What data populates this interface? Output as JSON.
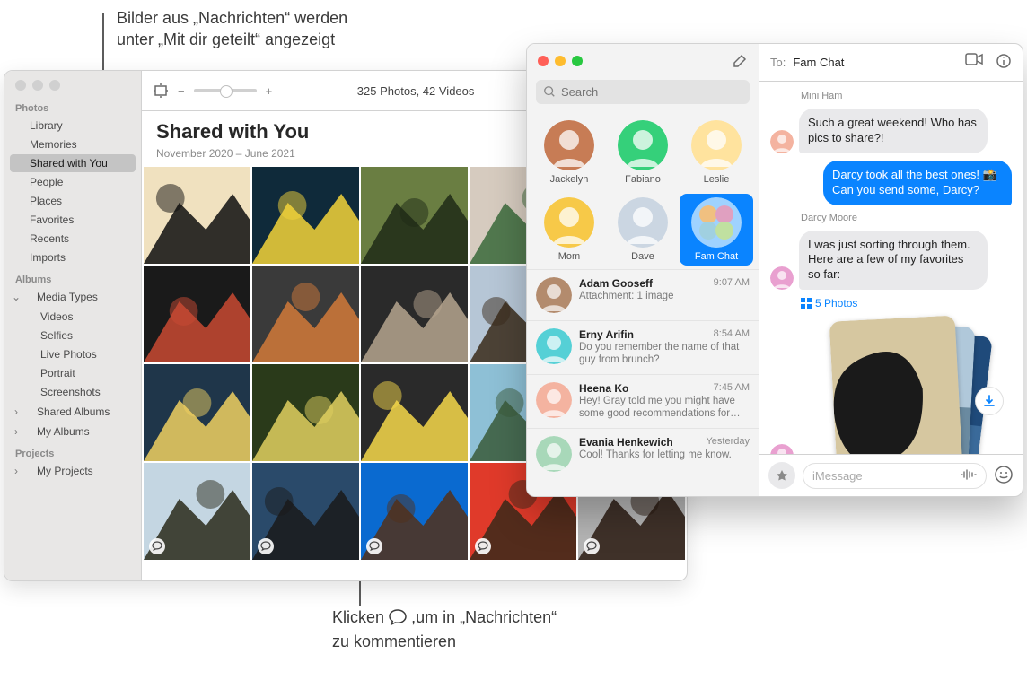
{
  "callouts": {
    "top_line1": "Bilder aus „Nachrichten“ werden",
    "top_line2": "unter „Mit dir geteilt“ angezeigt",
    "bottom_pre": "Klicken",
    "bottom_post": ",um in „Nachrichten“",
    "bottom_line2": "zu kommentieren"
  },
  "photos": {
    "toolbar": {
      "count": "325 Photos, 42 Videos"
    },
    "header": {
      "title": "Shared with You",
      "subtitle": "November 2020 – June 2021"
    },
    "sidebar": {
      "section_photos": "Photos",
      "items_photos": [
        "Library",
        "Memories",
        "Shared with You",
        "People",
        "Places",
        "Favorites",
        "Recents",
        "Imports"
      ],
      "section_albums": "Albums",
      "media_types_label": "Media Types",
      "media_types": [
        "Videos",
        "Selfies",
        "Live Photos",
        "Portrait",
        "Screenshots"
      ],
      "shared_albums": "Shared Albums",
      "my_albums": "My Albums",
      "section_projects": "Projects",
      "my_projects": "My Projects"
    }
  },
  "messages": {
    "search_placeholder": "Search",
    "pins": [
      {
        "name": "Jackelyn",
        "bg": "#c77c55"
      },
      {
        "name": "Fabiano",
        "bg": "#35d07a"
      },
      {
        "name": "Leslie",
        "bg": "#ffe39e"
      },
      {
        "name": "Mom",
        "bg": "#f7c948"
      },
      {
        "name": "Dave",
        "bg": "#cbd6e2"
      },
      {
        "name": "Fam Chat",
        "bg": "#9fd2ff"
      }
    ],
    "conversations": [
      {
        "name": "Adam Gooseff",
        "time": "9:07 AM",
        "preview": "Attachment: 1 image",
        "bg": "#b38b6d"
      },
      {
        "name": "Erny Arifin",
        "time": "8:54 AM",
        "preview": "Do you remember the name of that guy from brunch?",
        "bg": "#55d0d6"
      },
      {
        "name": "Heena Ko",
        "time": "7:45 AM",
        "preview": "Hey! Gray told me you might have some good recommendations for our…",
        "bg": "#f4b3a0"
      },
      {
        "name": "Evania Henkewich",
        "time": "Yesterday",
        "preview": "Cool! Thanks for letting me know.",
        "bg": "#a8d8b9"
      }
    ],
    "header": {
      "to_label": "To:",
      "to_value": "Fam Chat"
    },
    "thread": {
      "sender1": "Mini Ham",
      "msg1": "Such a great weekend! Who has pics to share?!",
      "msg_me": "Darcy took all the best ones! 📸 Can you send some, Darcy?",
      "sender2": "Darcy Moore",
      "msg2": "I was just sorting through them. Here are a few of my favorites so far:",
      "stack_label": "5 Photos"
    },
    "composer": {
      "placeholder": "iMessage"
    }
  },
  "photo_cells": [
    {
      "c1": "#f0e1bf",
      "c2": "#0e0e0e"
    },
    {
      "c1": "#0f2a3a",
      "c2": "#f3d33a"
    },
    {
      "c1": "#6a7e42",
      "c2": "#1e2a16"
    },
    {
      "c1": "#d6cbbf",
      "c2": "#3a6a3a"
    },
    {
      "c1": "#b9cbb9",
      "c2": "#6a4a2a"
    },
    {
      "c1": "#1a1a1a",
      "c2": "#c94a33"
    },
    {
      "c1": "#3a3a3a",
      "c2": "#d27a3a"
    },
    {
      "c1": "#2a2a2a",
      "c2": "#b5a48e"
    },
    {
      "c1": "#b6c6d6",
      "c2": "#3a2a1a"
    },
    {
      "c1": "#e0d6cb",
      "c2": "#3a2a1a"
    },
    {
      "c1": "#1f364a",
      "c2": "#f0d060"
    },
    {
      "c1": "#2a3a1a",
      "c2": "#e0d060"
    },
    {
      "c1": "#2a2a2a",
      "c2": "#f6d84a"
    },
    {
      "c1": "#8ec0d6",
      "c2": "#3a5a3a"
    },
    {
      "c1": "#d6e0cb",
      "c2": "#3a2a1a"
    },
    {
      "c1": "#c4d6e2",
      "c2": "#2a2a1a"
    },
    {
      "c1": "#2a4a6a",
      "c2": "#1a1a1a"
    },
    {
      "c1": "#0a6ad0",
      "c2": "#52301a"
    },
    {
      "c1": "#e03a2a",
      "c2": "#3a2a1a"
    },
    {
      "c1": "#b5b5b5",
      "c2": "#2a1a10"
    }
  ]
}
